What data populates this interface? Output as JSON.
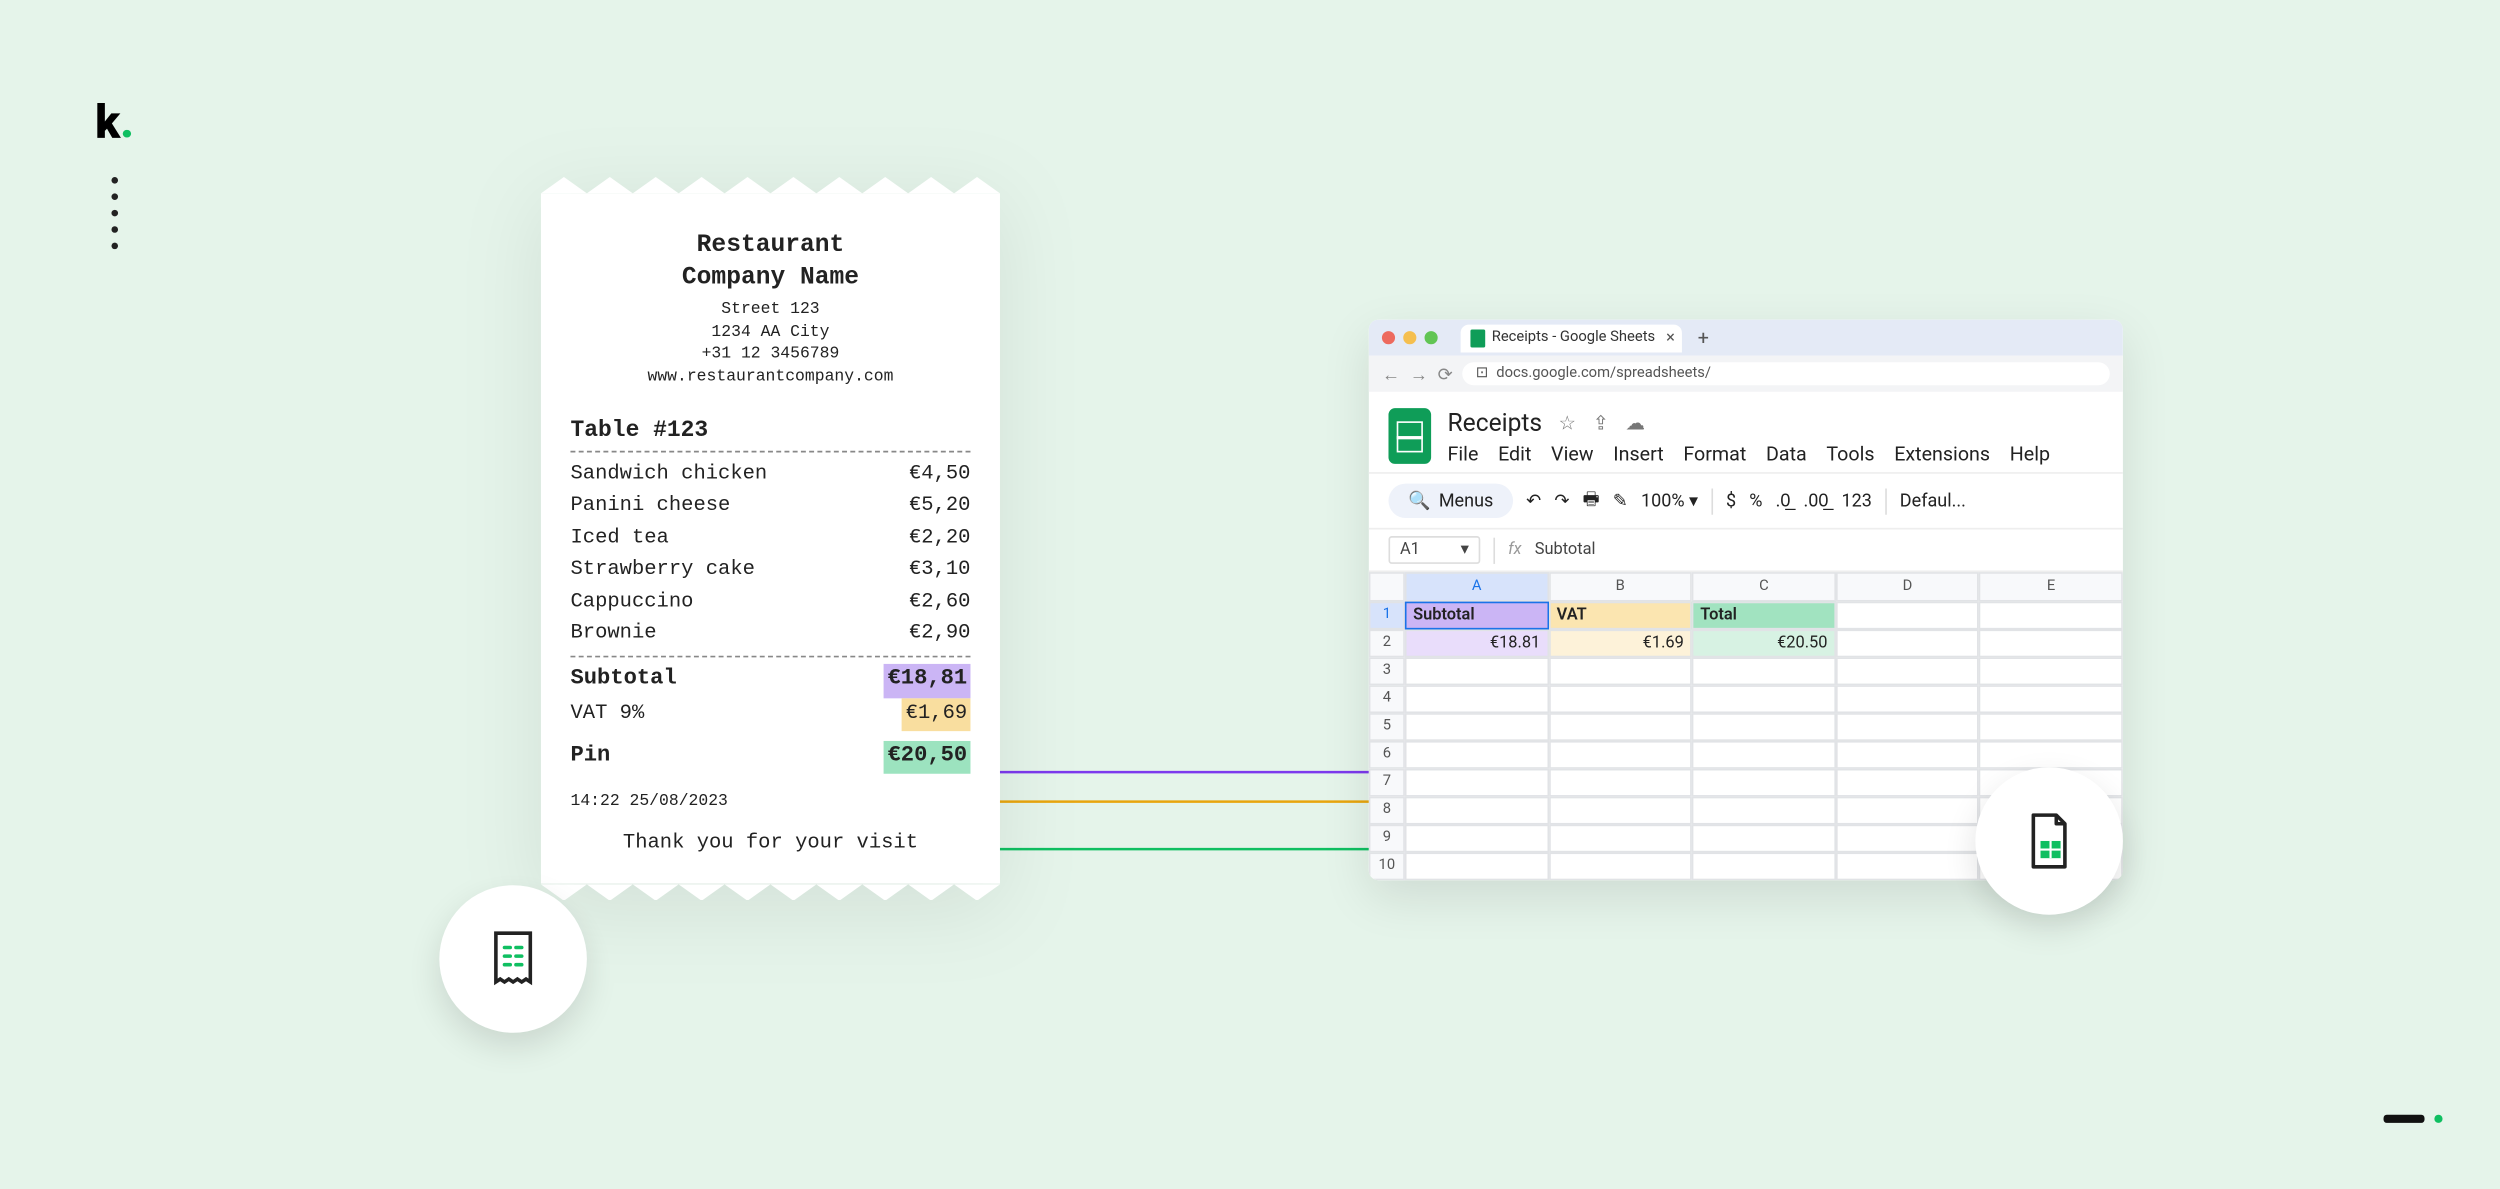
{
  "receipt": {
    "title_line1": "Restaurant",
    "title_line2": "Company Name",
    "street": "Street 123",
    "city": "1234 AA City",
    "phone": "+31 12 3456789",
    "website": "www.restaurantcompany.com",
    "table_label": "Table #123",
    "items": [
      {
        "name": "Sandwich chicken",
        "price": "€4,50"
      },
      {
        "name": "Panini cheese",
        "price": "€5,20"
      },
      {
        "name": "Iced tea",
        "price": "€2,20"
      },
      {
        "name": "Strawberry cake",
        "price": "€3,10"
      },
      {
        "name": "Cappuccino",
        "price": "€2,60"
      },
      {
        "name": "Brownie",
        "price": "€2,90"
      }
    ],
    "subtotal_label": "Subtotal",
    "subtotal_value": "€18,81",
    "vat_label": "VAT 9%",
    "vat_value": "€1,69",
    "pin_label": "Pin",
    "pin_value": "€20,50",
    "timestamp": "14:22 25/08/2023",
    "thanks": "Thank you for your visit"
  },
  "browser": {
    "tab_title": "Receipts - Google Sheets",
    "url": "docs.google.com/spreadsheets/"
  },
  "sheets": {
    "doc_title": "Receipts",
    "menu": [
      "File",
      "Edit",
      "View",
      "Insert",
      "Format",
      "Data",
      "Tools",
      "Extensions",
      "Help"
    ],
    "search_label": "Menus",
    "zoom": "100%",
    "currency": "$",
    "percent": "%",
    "num_format": "123",
    "font": "Defaul...",
    "active_cell": "A1",
    "formula_value": "Subtotal",
    "columns": [
      "A",
      "B",
      "C",
      "D",
      "E"
    ],
    "rows": [
      "1",
      "2",
      "3",
      "4",
      "5",
      "6",
      "7",
      "8",
      "9",
      "10"
    ],
    "headers": {
      "a": "Subtotal",
      "b": "VAT",
      "c": "Total"
    },
    "values": {
      "a": "€18.81",
      "b": "€1.69",
      "c": "€20.50"
    }
  },
  "colors": {
    "purple": "#8B5CF6",
    "amber": "#F0B429",
    "green": "#10B981"
  }
}
